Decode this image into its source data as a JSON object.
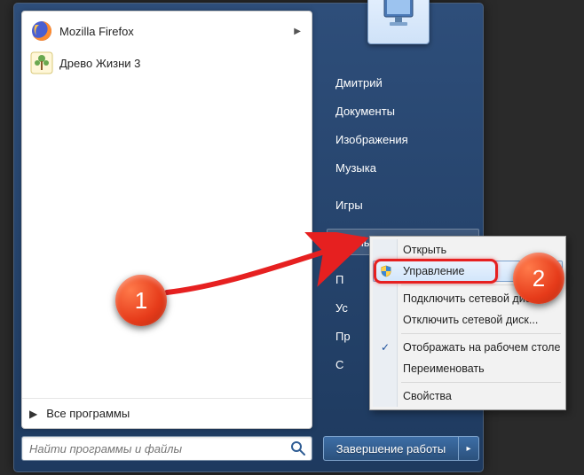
{
  "steps": {
    "one": "1",
    "two": "2"
  },
  "programs": [
    {
      "label": "Mozilla Firefox",
      "icon": "firefox",
      "submenu": true
    },
    {
      "label": "Древо Жизни 3",
      "icon": "tree",
      "submenu": false
    }
  ],
  "all_programs": "Все программы",
  "search": {
    "placeholder": "Найти программы и файлы"
  },
  "right": {
    "user": "Дмитрий",
    "documents": "Документы",
    "images": "Изображения",
    "music": "Музыка",
    "games": "Игры",
    "computer": "Компьютер",
    "control_panel_short": "П",
    "devices_short": "Ус",
    "default_short": "Пр",
    "help_short": "С"
  },
  "shutdown": {
    "label": "Завершение работы"
  },
  "context_menu": {
    "open": "Открыть",
    "manage": "Управление",
    "map_drive": "Подключить сетевой диск...",
    "disconnect_drive": "Отключить сетевой диск...",
    "show_desktop": "Отображать на рабочем столе",
    "rename": "Переименовать",
    "properties": "Свойства"
  }
}
